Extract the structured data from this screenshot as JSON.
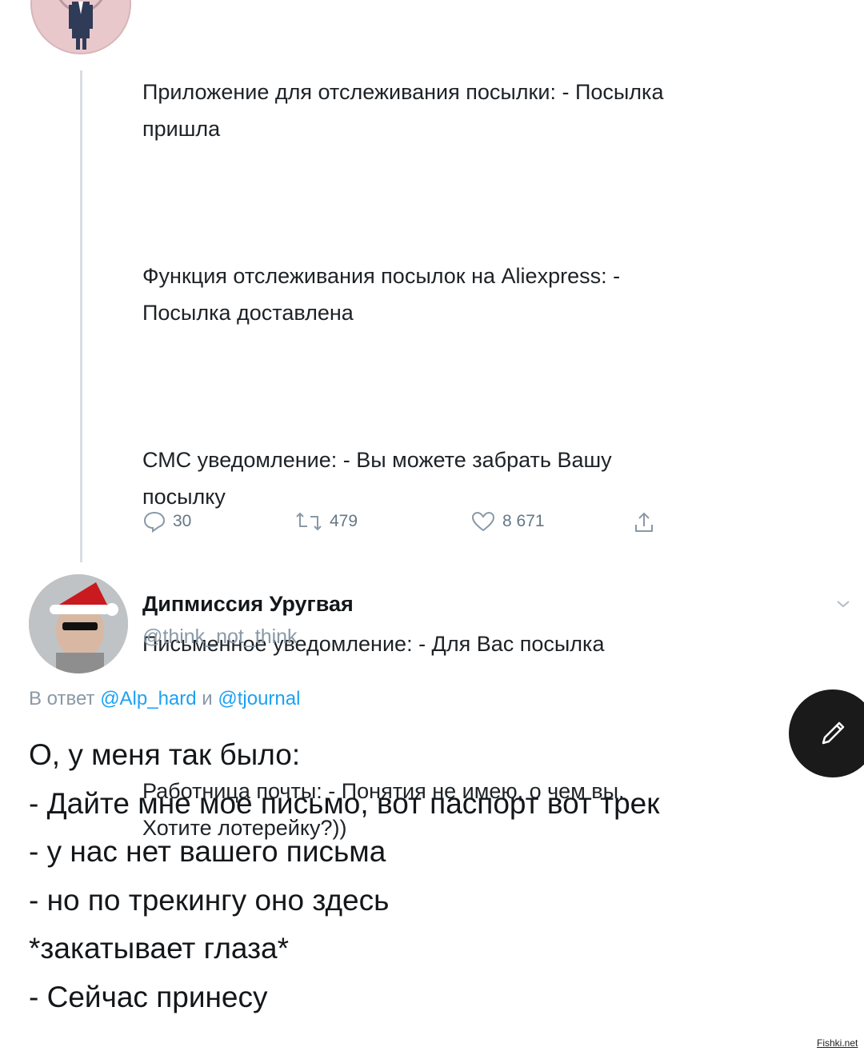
{
  "tweet1": {
    "avatar_icon": "man-in-suit-avatar-icon",
    "paragraphs": [
      "Приложение для отслеживания посылки: - Посылка\nпришла",
      "Функция отслеживания посылок на Aliexpress: -\nПосылка доставлена",
      "СМС уведомление: - Вы можете забрать Вашу\nпосылку",
      "Письменное уведомление: - Для Вас посылка",
      "Работница почты: - Понятия не имею, о чем вы.\nХотите лотерейку?))"
    ],
    "actions": {
      "replies": "30",
      "retweets": "479",
      "likes": "8 671"
    }
  },
  "tweet2": {
    "avatar_icon": "santa-hat-man-avatar-icon",
    "author_name": "Дипмиссия Уругвая",
    "author_handle": "@think_not_think",
    "reply_prefix": "В ответ",
    "reply_mention_1": "@Alp_hard",
    "reply_joiner": "и",
    "reply_mention_2": "@tjournal",
    "lines": [
      "О, у меня так было:",
      "- Дайте мне мое письмо, вот паспорт вот трек",
      "- у нас нет вашего письма",
      "- но по трекингу оно здесь",
      "*закатывает глаза*",
      "- Сейчас принесу"
    ]
  },
  "compose_fab_icon": "pencil-icon",
  "watermark": "Fishki.net",
  "colors": {
    "secondary_text": "#8a99a6",
    "mention": "#1da1f2",
    "thread_line": "#d9dde1",
    "fab_bg": "#1a1a1a"
  }
}
